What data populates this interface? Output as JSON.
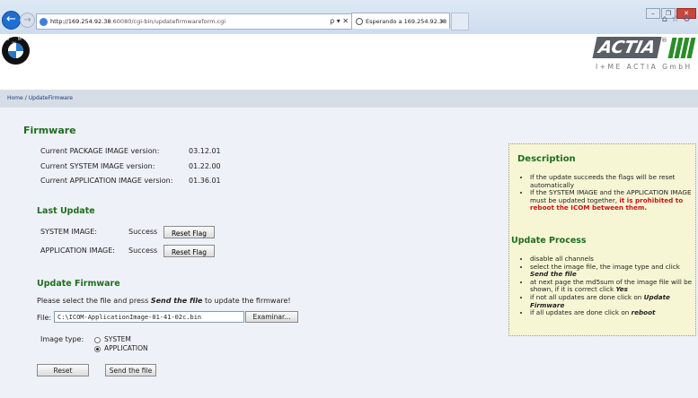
{
  "browser": {
    "url_host": "http://169.254.92.38",
    "url_path": ":60080/cgi-bin/updatefirmwareform.cgi",
    "search_glyph": "ρ ▾ ✕",
    "tab_title": "Esperando a 169.254.92.38",
    "tab_close": "✕",
    "back_glyph": "←",
    "forward_glyph": "→",
    "toolbar_glyphs": "⌂☆⚙",
    "window_buttons": [
      "–",
      "❐",
      "✕"
    ]
  },
  "header": {
    "bmw_letters": "B M W",
    "actia_wordmark": "ACTIA",
    "actia_reg": "®",
    "actia_subtitle": "I+ME ACTIA GmbH"
  },
  "breadcrumb": {
    "home": "Home",
    "separator": "/",
    "current": "UpdateFirmware"
  },
  "firmware": {
    "title": "Firmware",
    "rows": [
      {
        "label": "Current PACKAGE IMAGE version:",
        "value": "03.12.01"
      },
      {
        "label": "Current SYSTEM IMAGE version:",
        "value": "01.22.00"
      },
      {
        "label": "Current APPLICATION IMAGE version:",
        "value": "01.36.01"
      }
    ]
  },
  "last_update": {
    "title": "Last Update",
    "rows": [
      {
        "label": "SYSTEM IMAGE:",
        "status": "Success",
        "button": "Reset Flag"
      },
      {
        "label": "APPLICATION IMAGE:",
        "status": "Success",
        "button": "Reset Flag"
      }
    ]
  },
  "update_firmware": {
    "title": "Update Firmware",
    "instructions_pre": "Please select the file and press ",
    "instructions_emph": "Send the file",
    "instructions_post": " to update the firmware!",
    "file_label": "File:",
    "file_value": "C:\\ICOM-ApplicationImage-01-41-02c.bin",
    "browse_label": "Examinar...",
    "image_type_label": "Image type:",
    "options": [
      {
        "label": "SYSTEM",
        "checked": false
      },
      {
        "label": "APPLICATION",
        "checked": true
      }
    ],
    "reset_label": "Reset",
    "send_label": "Send the file"
  },
  "description": {
    "title": "Description",
    "item1": "If the update succeeds the flags will be reset automatically",
    "item2_pre": "If the SYSTEM IMAGE and the APPLICATION IMAGE must be updated together, ",
    "item2_red": "it is prohibited to reboot the ICOM between them.",
    "process_title": "Update Process",
    "p1": "disable all channels",
    "p2_pre": "select the image file, the image type and click ",
    "p2_emph": "Send the file",
    "p3_pre": "at next page the md5sum of the image file will be shown, if it is correct click ",
    "p3_emph": "Yes",
    "p4_pre": "if not all updates are done click on ",
    "p4_emph": "Update Firmware",
    "p5_pre": "if all updates are done click on ",
    "p5_emph": "reboot"
  },
  "colors": {
    "heading_green": "#1f6e1f",
    "warning_red": "#cc1111",
    "panel_bg": "#f6f6d4",
    "actia_green": "#2a8c2a"
  }
}
